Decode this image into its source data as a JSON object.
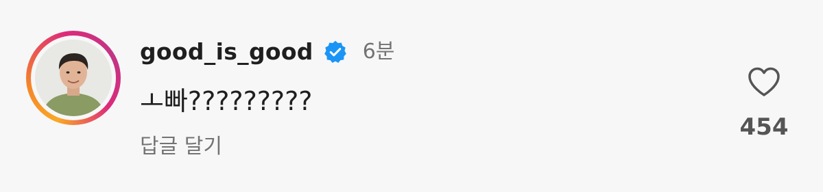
{
  "comment": {
    "username": "good_is_good",
    "verified": true,
    "time": "6분",
    "text": "ㅗ빠?????????",
    "reply_label": "답글 달기",
    "like_count": "454",
    "liked": false
  },
  "colors": {
    "verified_badge": "#1b95f5",
    "story_ring_start": "#f9a825",
    "story_ring_end": "#c13584",
    "username": "#1f1f1f",
    "secondary_text": "#737373"
  },
  "icons": {
    "verified": "verified-badge-icon",
    "like": "heart-outline-icon"
  }
}
